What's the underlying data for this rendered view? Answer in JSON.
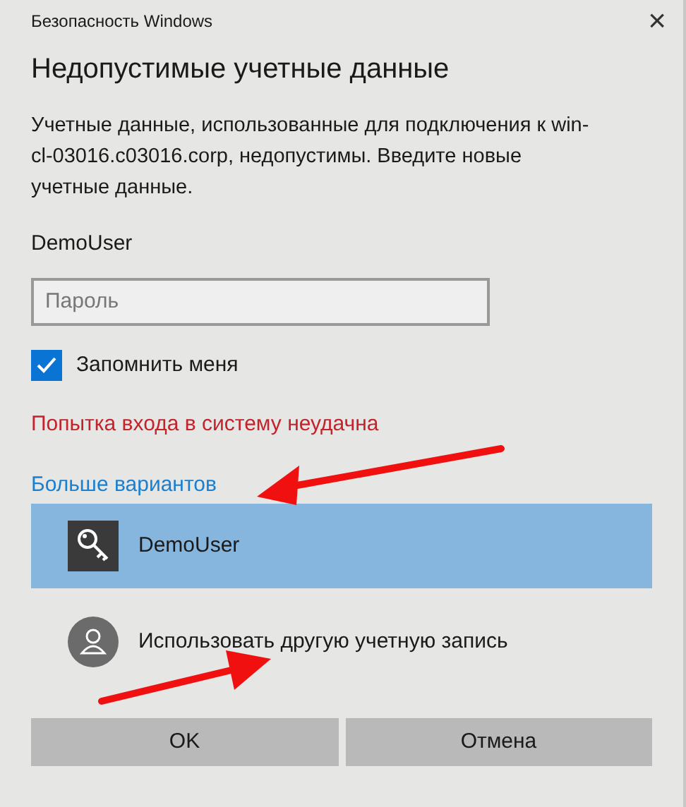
{
  "window": {
    "title": "Безопасность Windows",
    "close": "×"
  },
  "heading": "Недопустимые учетные данные",
  "message": "Учетные данные, использованные для подключения к win-cl-03016.c03016.corp, недопустимы. Введите новые учетные данные.",
  "username": "DemoUser",
  "password": {
    "placeholder": "Пароль"
  },
  "remember": {
    "label": "Запомнить меня",
    "checked": true
  },
  "error": "Попытка входа в систему неудачна",
  "more_options": "Больше вариантов",
  "accounts": [
    {
      "kind": "key",
      "label": "DemoUser",
      "selected": true
    },
    {
      "kind": "person",
      "label": "Использовать другую учетную запись",
      "selected": false
    }
  ],
  "buttons": [
    "OK",
    "Отмена"
  ]
}
